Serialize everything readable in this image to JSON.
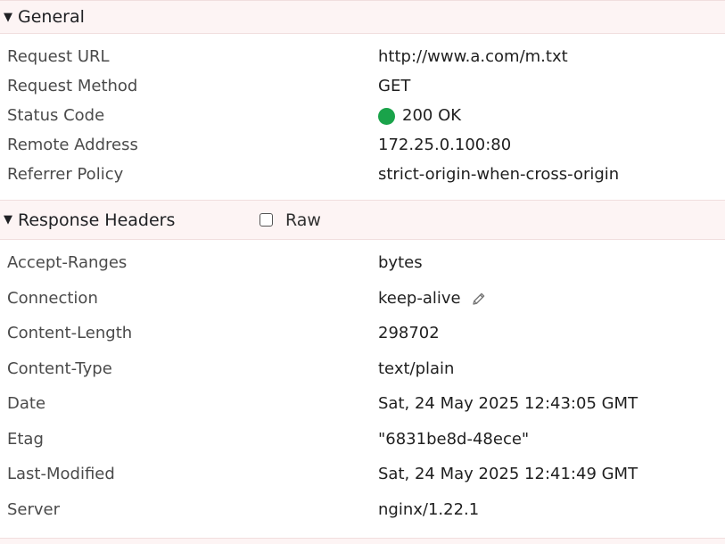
{
  "general": {
    "title": "General",
    "rows": [
      {
        "key": "Request URL",
        "value": "http://www.a.com/m.txt"
      },
      {
        "key": "Request Method",
        "value": "GET"
      },
      {
        "key": "Status Code",
        "value": "200 OK"
      },
      {
        "key": "Remote Address",
        "value": "172.25.0.100:80"
      },
      {
        "key": "Referrer Policy",
        "value": "strict-origin-when-cross-origin"
      }
    ]
  },
  "response_headers": {
    "title": "Response Headers",
    "raw_label": "Raw",
    "raw_checked": false,
    "rows": [
      {
        "key": "Accept-Ranges",
        "value": "bytes"
      },
      {
        "key": "Connection",
        "value": "keep-alive"
      },
      {
        "key": "Content-Length",
        "value": "298702"
      },
      {
        "key": "Content-Type",
        "value": "text/plain"
      },
      {
        "key": "Date",
        "value": "Sat, 24 May 2025 12:43:05 GMT"
      },
      {
        "key": "Etag",
        "value": "\"6831be8d-48ece\""
      },
      {
        "key": "Last-Modified",
        "value": "Sat, 24 May 2025 12:41:49 GMT"
      },
      {
        "key": "Server",
        "value": "nginx/1.22.1"
      }
    ]
  },
  "colors": {
    "status_ok": "#1aa34a",
    "header_bg": "#fdf4f4"
  },
  "icons": {
    "section_toggle": "triangle-down-icon",
    "status": "status-dot-icon",
    "edit": "pencil-icon"
  }
}
